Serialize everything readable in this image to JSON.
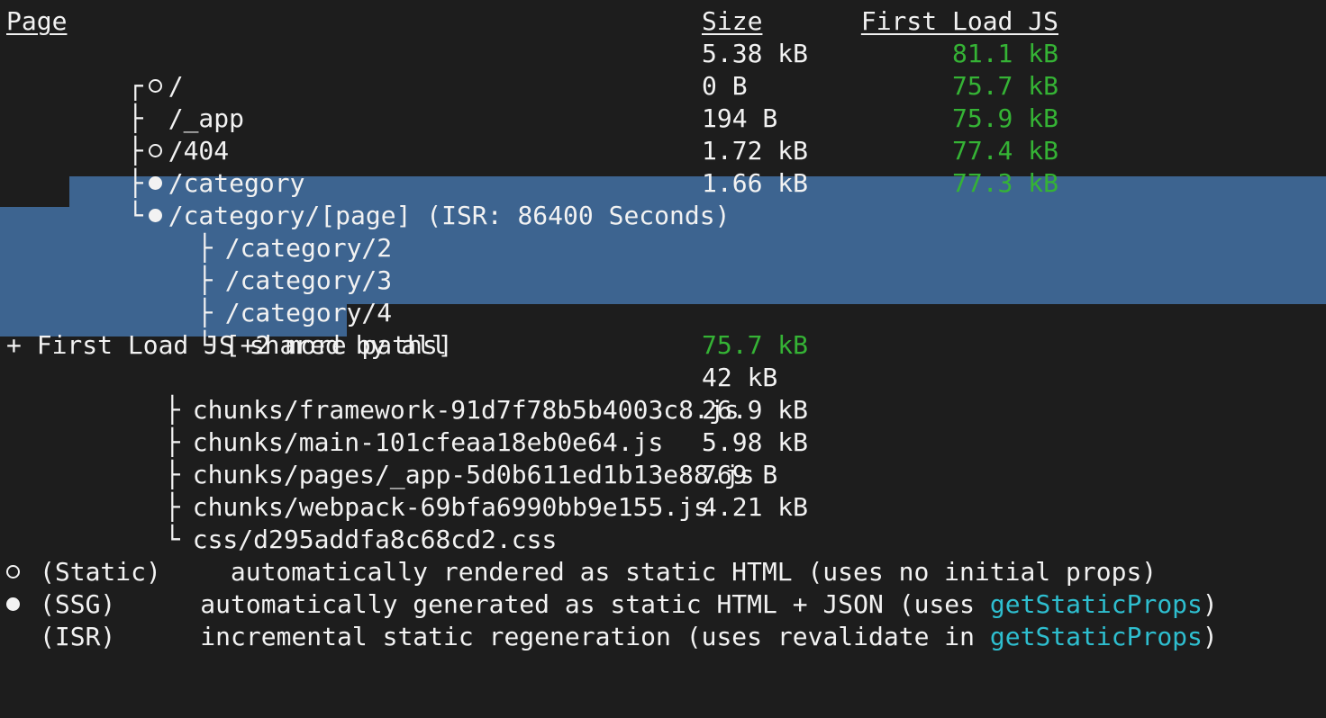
{
  "terminal": {
    "background": "#1d1d1d",
    "foreground": "#f2f2f2",
    "selection_color": "#3d6490",
    "green": "#35b335",
    "cyan": "#2ebecf"
  },
  "table": {
    "headers": {
      "page": "Page",
      "size": "Size",
      "first_load_js": "First Load JS"
    },
    "rows": [
      {
        "tree": "┌",
        "marker": "static",
        "page": "/",
        "size": "5.38 kB",
        "first_load_js": "81.1 kB",
        "selected": false
      },
      {
        "tree": "├",
        "marker": "none",
        "page": "/_app",
        "size": "0 B",
        "first_load_js": "75.7 kB",
        "selected": false
      },
      {
        "tree": "├",
        "marker": "static",
        "page": "/404",
        "size": "194 B",
        "first_load_js": "75.9 kB",
        "selected": false
      },
      {
        "tree": "├",
        "marker": "ssg",
        "page": "/category",
        "size": "1.72 kB",
        "first_load_js": "77.4 kB",
        "selected": false
      },
      {
        "tree": "└",
        "marker": "ssg",
        "page": "/category/[page] (ISR: 86400 Seconds)",
        "size": "1.66 kB",
        "first_load_js": "77.3 kB",
        "selected": true
      }
    ],
    "sub_paths": [
      {
        "tree": "├",
        "path": "/category/2",
        "selected": true
      },
      {
        "tree": "├",
        "path": "/category/3",
        "selected": true
      },
      {
        "tree": "├",
        "path": "/category/4",
        "selected": true
      },
      {
        "tree": "└",
        "path": "[+2 more paths]",
        "selected": true
      }
    ]
  },
  "shared": {
    "title": "+ First Load JS shared by all",
    "title_size": "75.7 kB",
    "chunks": [
      {
        "tree": "├",
        "name": "chunks/framework-91d7f78b5b4003c8.js",
        "size": "42 kB"
      },
      {
        "tree": "├",
        "name": "chunks/main-101cfeaa18eb0e64.js",
        "size": "26.9 kB"
      },
      {
        "tree": "├",
        "name": "chunks/pages/_app-5d0b611ed1b13e88.js",
        "size": "5.98 kB"
      },
      {
        "tree": "├",
        "name": "chunks/webpack-69bfa6990bb9e155.js",
        "size": "769 B"
      },
      {
        "tree": "└",
        "name": "css/d295addfa8c68cd2.css",
        "size": "4.21 kB"
      }
    ]
  },
  "legend": [
    {
      "marker": "static",
      "label": "(Static)",
      "text_before": "automatically rendered as static HTML (uses no initial props)",
      "code": "",
      "text_after": ""
    },
    {
      "marker": "ssg",
      "label": "(SSG)",
      "text_before": "automatically generated as static HTML + JSON (uses ",
      "code": "getStaticProps",
      "text_after": ")"
    },
    {
      "marker": "none",
      "label": "(ISR)",
      "text_before": "incremental static regeneration (uses revalidate in ",
      "code": "getStaticProps",
      "text_after": ")"
    }
  ]
}
